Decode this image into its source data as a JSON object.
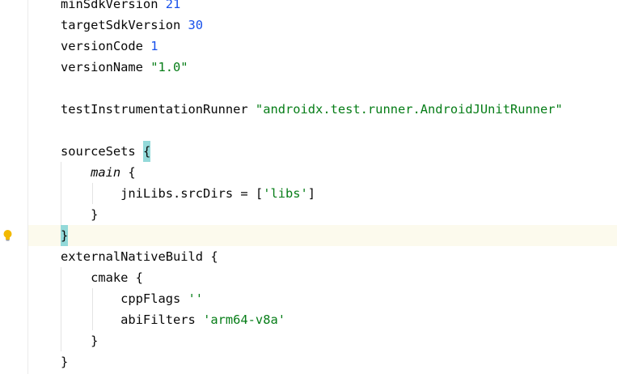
{
  "editor": {
    "lines": [
      {
        "segments": [
          {
            "t": "minSdkVersion ",
            "c": "plain"
          },
          {
            "t": "21",
            "c": "num"
          }
        ]
      },
      {
        "segments": [
          {
            "t": "targetSdkVersion ",
            "c": "plain"
          },
          {
            "t": "30",
            "c": "num"
          }
        ]
      },
      {
        "segments": [
          {
            "t": "versionCode ",
            "c": "plain"
          },
          {
            "t": "1",
            "c": "num"
          }
        ]
      },
      {
        "segments": [
          {
            "t": "versionName ",
            "c": "plain"
          },
          {
            "t": "\"1.0\"",
            "c": "str"
          }
        ]
      },
      {
        "segments": []
      },
      {
        "segments": [
          {
            "t": "testInstrumentationRunner ",
            "c": "plain"
          },
          {
            "t": "\"androidx.test.runner.AndroidJUnitRunner\"",
            "c": "str"
          }
        ]
      },
      {
        "segments": []
      },
      {
        "segments": [
          {
            "t": "sourceSets ",
            "c": "plain"
          },
          {
            "t": "{",
            "c": "brace-hl"
          }
        ]
      },
      {
        "segments": [
          {
            "t": "    ",
            "c": "plain"
          },
          {
            "t": "main",
            "c": "ital"
          },
          {
            "t": " {",
            "c": "plain"
          }
        ]
      },
      {
        "segments": [
          {
            "t": "        jniLibs.srcDirs = [",
            "c": "plain"
          },
          {
            "t": "'libs'",
            "c": "str"
          },
          {
            "t": "]",
            "c": "plain"
          }
        ]
      },
      {
        "segments": [
          {
            "t": "    }",
            "c": "plain"
          }
        ]
      },
      {
        "segments": [
          {
            "t": "}",
            "c": "brace-hl"
          }
        ],
        "caret_line": true
      },
      {
        "segments": [
          {
            "t": "externalNativeBuild {",
            "c": "plain"
          }
        ]
      },
      {
        "segments": [
          {
            "t": "    cmake {",
            "c": "plain"
          }
        ]
      },
      {
        "segments": [
          {
            "t": "        cppFlags ",
            "c": "plain"
          },
          {
            "t": "''",
            "c": "str"
          }
        ]
      },
      {
        "segments": [
          {
            "t": "        abiFilters ",
            "c": "plain"
          },
          {
            "t": "'arm64-v8a'",
            "c": "str"
          }
        ]
      },
      {
        "segments": [
          {
            "t": "    }",
            "c": "plain"
          }
        ]
      },
      {
        "segments": [
          {
            "t": "}",
            "c": "plain"
          }
        ]
      }
    ]
  },
  "gutter": {
    "intention_icon": "lightbulb-icon"
  },
  "colors": {
    "background": "#ffffff",
    "caret_line": "#fcfaed",
    "number": "#1750eb",
    "string": "#067d17",
    "brace_highlight": "#93d9d9",
    "text": "#080808",
    "lightbulb": "#f2b900"
  }
}
